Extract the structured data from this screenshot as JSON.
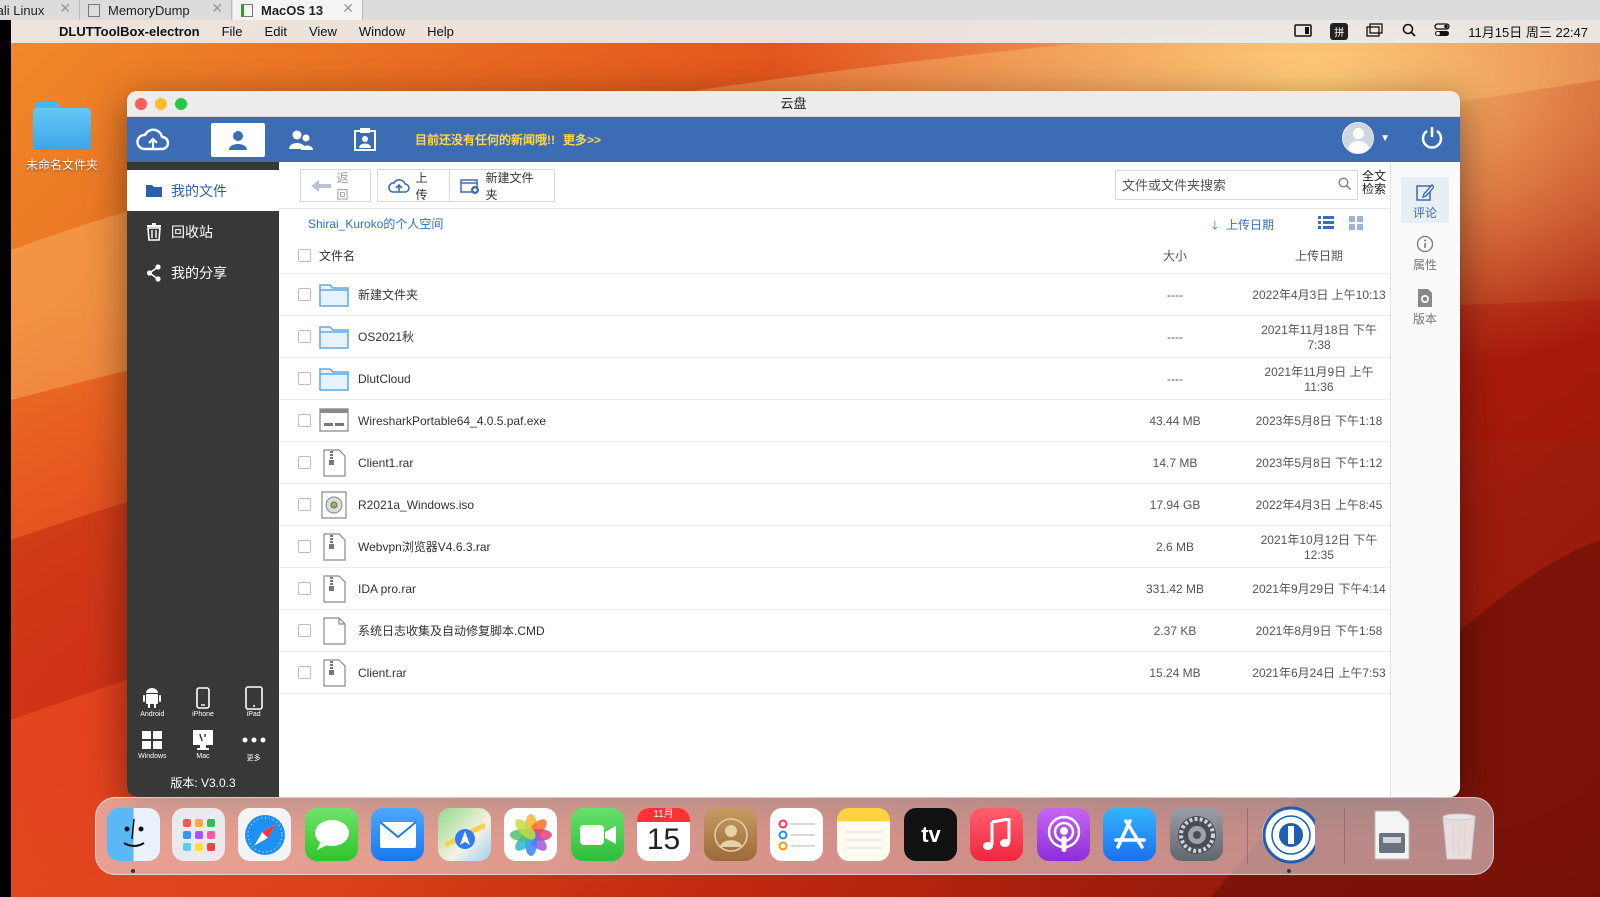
{
  "vm_tabs": [
    {
      "label": "Kali Linux"
    },
    {
      "label": "MemoryDump"
    },
    {
      "label": "MacOS 13"
    }
  ],
  "menubar": {
    "app_name": "DLUTToolBox-electron",
    "menus": [
      "File",
      "Edit",
      "View",
      "Window",
      "Help"
    ],
    "ime": "拼",
    "clock": "11月15日 周三  22:47"
  },
  "desktop": {
    "folder_label": "未命名文件夹"
  },
  "window": {
    "title": "云盘",
    "news": "目前还没有任何的新闻哦!!",
    "news_more": "更多>>"
  },
  "sidebar": {
    "items": [
      {
        "label": "我的文件",
        "icon": "folder-icon"
      },
      {
        "label": "回收站",
        "icon": "trash-icon"
      },
      {
        "label": "我的分享",
        "icon": "share-icon"
      }
    ],
    "platforms": [
      {
        "label": "Android",
        "icon": "android-icon"
      },
      {
        "label": "iPhone",
        "icon": "iphone-icon"
      },
      {
        "label": "iPad",
        "icon": "ipad-icon"
      },
      {
        "label": "Windows",
        "icon": "windows-icon"
      },
      {
        "label": "Mac",
        "icon": "mac-icon"
      },
      {
        "label": "更多",
        "icon": "more-icon"
      }
    ],
    "version": "版本: V3.0.3"
  },
  "toolbar": {
    "back": "返回",
    "upload": "上传",
    "new_folder": "新建文件夹",
    "search_placeholder": "文件或文件夹搜索",
    "fulltext_line1": "全文",
    "fulltext_line2": "检索"
  },
  "pathbar": {
    "breadcrumb": "Shirai_Kuroko的个人空间",
    "sort_by": "上传日期"
  },
  "table": {
    "headers": {
      "name": "文件名",
      "size": "大小",
      "date": "上传日期"
    },
    "rows": [
      {
        "name": "新建文件夹",
        "size": "----",
        "date": "2022年4月3日 上午10:13",
        "type": "folder"
      },
      {
        "name": "OS2021秋",
        "size": "----",
        "date": "2021年11月18日 下午7:38",
        "type": "folder"
      },
      {
        "name": "DlutCloud",
        "size": "----",
        "date": "2021年11月9日 上午11:36",
        "type": "folder"
      },
      {
        "name": "WiresharkPortable64_4.0.5.paf.exe",
        "size": "43.44 MB",
        "date": "2023年5月8日 下午1:18",
        "type": "exe"
      },
      {
        "name": "Client1.rar",
        "size": "14.7 MB",
        "date": "2023年5月8日 下午1:12",
        "type": "archive"
      },
      {
        "name": "R2021a_Windows.iso",
        "size": "17.94 GB",
        "date": "2022年4月3日 上午8:45",
        "type": "iso"
      },
      {
        "name": "Webvpn浏览器V4.6.3.rar",
        "size": "2.6 MB",
        "date": "2021年10月12日 下午12:35",
        "type": "archive"
      },
      {
        "name": "IDA pro.rar",
        "size": "331.42 MB",
        "date": "2021年9月29日 下午4:14",
        "type": "archive"
      },
      {
        "name": "系统日志收集及自动修复脚本.CMD",
        "size": "2.37 KB",
        "date": "2021年8月9日 下午1:58",
        "type": "file"
      },
      {
        "name": "Client.rar",
        "size": "15.24 MB",
        "date": "2021年6月24日 上午7:53",
        "type": "archive"
      }
    ]
  },
  "right_panel": {
    "items": [
      {
        "label": "评论",
        "icon": "comment-edit-icon"
      },
      {
        "label": "属性",
        "icon": "info-icon"
      },
      {
        "label": "版本",
        "icon": "version-icon"
      }
    ]
  },
  "dock": {
    "calendar_month": "11月",
    "calendar_day": "15",
    "tv_label": "tv",
    "apps": [
      "finder",
      "launchpad",
      "safari",
      "messages",
      "mail",
      "maps",
      "photos",
      "facetime",
      "calendar",
      "contacts",
      "reminders",
      "notes",
      "apple-tv",
      "music",
      "podcasts",
      "app-store",
      "system-settings",
      "university-seal",
      "downloads",
      "trash"
    ]
  },
  "colors": {
    "nav_blue": "#3c6cb4",
    "sidebar_dark": "#383838",
    "news_yellow": "#ffd54a",
    "link_blue": "#2f6fc4"
  }
}
